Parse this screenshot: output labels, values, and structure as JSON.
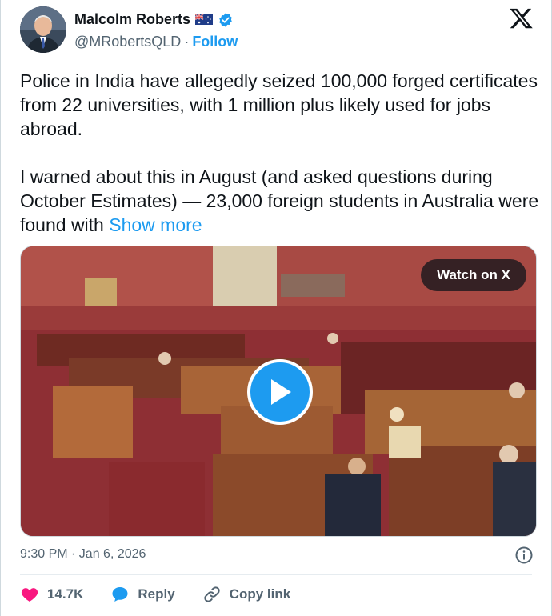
{
  "author": {
    "name": "Malcolm Roberts",
    "handle": "@MRobertsQLD",
    "separator": "·",
    "follow_label": "Follow"
  },
  "icons": {
    "flag": "australian-flag-icon",
    "verified": "verified-badge-icon",
    "platform": "x-logo-icon",
    "info": "info-icon",
    "like": "heart-icon",
    "reply": "reply-bubble-icon",
    "copy": "link-icon",
    "play": "play-icon"
  },
  "tweet": {
    "text": "Police in India have allegedly seized 100,000 forged certificates from 22 universities, with 1 million plus likely used for jobs abroad.\n\nI warned about this in August (and asked questions during October Estimates) — 23,000 foreign students in Australia were found with ",
    "show_more": "Show more"
  },
  "media": {
    "watch_label": "Watch on X"
  },
  "meta": {
    "timestamp": "9:30 PM · Jan 6, 2026"
  },
  "actions": {
    "likes": "14.7K",
    "reply_label": "Reply",
    "copy_label": "Copy link"
  },
  "colors": {
    "accent": "#1d9bf0",
    "like": "#f91880",
    "text": "#0f1419",
    "muted": "#536471"
  }
}
